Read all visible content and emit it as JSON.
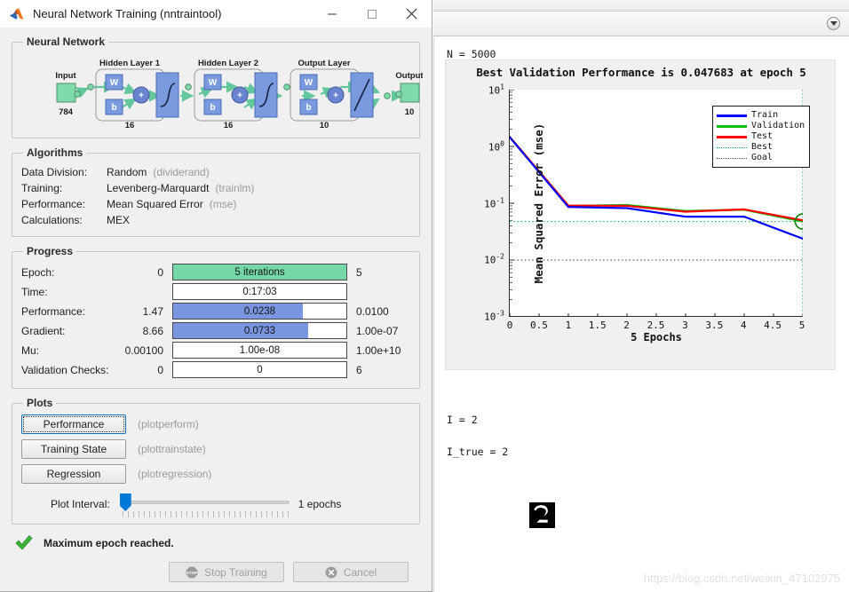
{
  "matlab_window": {
    "collapse_icon": "chevron-down-circle-icon",
    "console": {
      "lines": [
        {
          "text": "N = 5000",
          "value": "5000"
        },
        {
          "text": "I = 2",
          "value": "2"
        },
        {
          "text": "I_true = 2",
          "value": "2"
        }
      ],
      "n_label": "N = 5000",
      "i_label": "I = 2",
      "i_true_label": "I_true = 2",
      "digit_image_alt": "handwritten-digit-2"
    },
    "watermark": "https://blog.csdn.net/weixin_47102975"
  },
  "chart_data": {
    "type": "line",
    "title": "Best Validation Performance is 0.047683 at epoch 5",
    "xlabel": "5 Epochs",
    "ylabel": "Mean Squared Error (mse)",
    "yscale": "log",
    "ylim": [
      0.001,
      10
    ],
    "xlim": [
      0,
      5
    ],
    "grid": false,
    "legend_position": "upper right",
    "x": [
      0,
      1,
      2,
      3,
      4,
      5
    ],
    "xticks": [
      "0",
      "0.5",
      "1",
      "1.5",
      "2",
      "2.5",
      "3",
      "3.5",
      "4",
      "4.5",
      "5"
    ],
    "xtick_values": [
      0,
      0.5,
      1,
      1.5,
      2,
      2.5,
      3,
      3.5,
      4,
      4.5,
      5
    ],
    "yticks": [
      "10^1",
      "10^0",
      "10^-1",
      "10^-2",
      "10^-3"
    ],
    "ytick_values": [
      10,
      1,
      0.1,
      0.01,
      0.001
    ],
    "series": [
      {
        "name": "Train",
        "color": "#0000ff",
        "style": "solid",
        "values": [
          1.45,
          0.086,
          0.082,
          0.058,
          0.058,
          0.0238
        ]
      },
      {
        "name": "Validation",
        "color": "#00c000",
        "style": "solid",
        "values": [
          1.47,
          0.09,
          0.093,
          0.073,
          0.077,
          0.047683
        ]
      },
      {
        "name": "Test",
        "color": "#ff0000",
        "style": "solid",
        "values": [
          1.47,
          0.091,
          0.09,
          0.071,
          0.078,
          0.05
        ]
      },
      {
        "name": "Best",
        "color": "#00b050",
        "style": "dotted",
        "value": 0.047683
      },
      {
        "name": "Goal",
        "color": "#404040",
        "style": "dotted",
        "value": 0.01
      }
    ],
    "best_marker": {
      "x": 5,
      "y": 0.047683,
      "color": "#008000"
    },
    "best_value": 0.047683,
    "best_epoch": 5
  },
  "dialog": {
    "title": "Neural Network Training (nntraintool)",
    "title_icon": "matlab-logo-icon",
    "window_buttons": {
      "minimize": "minimize-icon",
      "maximize": "maximize-icon",
      "close": "close-icon"
    },
    "neural_network": {
      "legend": "Neural Network",
      "input_label": "Input",
      "input_size": "784",
      "output_label": "Output",
      "output_size": "10",
      "layers": [
        {
          "title": "Hidden Layer 1",
          "size": "16",
          "w": "W",
          "b": "b",
          "op": "+"
        },
        {
          "title": "Hidden Layer 2",
          "size": "16",
          "w": "W",
          "b": "b",
          "op": "+"
        },
        {
          "title": "Output Layer",
          "size": "10",
          "w": "W",
          "b": "b",
          "op": "+"
        }
      ]
    },
    "algorithms": {
      "legend": "Algorithms",
      "rows": [
        {
          "key": "Data Division:",
          "value": "Random",
          "fn": "(dividerand)"
        },
        {
          "key": "Training:",
          "value": "Levenberg-Marquardt",
          "fn": "(trainlm)"
        },
        {
          "key": "Performance:",
          "value": "Mean Squared Error",
          "fn": "(mse)"
        },
        {
          "key": "Calculations:",
          "value": "MEX",
          "fn": ""
        }
      ]
    },
    "progress": {
      "legend": "Progress",
      "rows": [
        {
          "name": "Epoch:",
          "left": "0",
          "bar": "5 iterations",
          "right": "5",
          "fill": 100,
          "color": "green"
        },
        {
          "name": "Time:",
          "left": "",
          "bar": "0:17:03",
          "right": "",
          "fill": 0,
          "color": "none"
        },
        {
          "name": "Performance:",
          "left": "1.47",
          "bar": "0.0238",
          "right": "0.0100",
          "fill": 75,
          "color": "blue"
        },
        {
          "name": "Gradient:",
          "left": "8.66",
          "bar": "0.0733",
          "right": "1.00e-07",
          "fill": 78,
          "color": "blue"
        },
        {
          "name": "Mu:",
          "left": "0.00100",
          "bar": "1.00e-08",
          "right": "1.00e+10",
          "fill": 0,
          "color": "none"
        },
        {
          "name": "Validation Checks:",
          "left": "0",
          "bar": "0",
          "right": "6",
          "fill": 0,
          "color": "none"
        }
      ]
    },
    "plots": {
      "legend": "Plots",
      "buttons": [
        {
          "label": "Performance",
          "fn": "(plotperform)",
          "focused": true
        },
        {
          "label": "Training State",
          "fn": "(plottrainstate)",
          "focused": false
        },
        {
          "label": "Regression",
          "fn": "(plotregression)",
          "focused": false
        }
      ],
      "interval_label": "Plot Interval:",
      "interval_value": "1 epochs"
    },
    "status": {
      "icon": "green-check-icon",
      "text": "Maximum epoch reached."
    },
    "actions": [
      {
        "label": "Stop Training",
        "icon": "stop-sign-icon",
        "disabled": true
      },
      {
        "label": "Cancel",
        "icon": "cancel-x-icon",
        "disabled": true
      }
    ]
  }
}
